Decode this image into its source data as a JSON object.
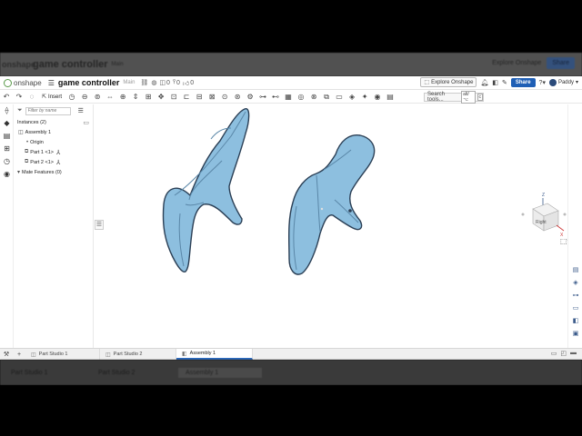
{
  "ghost": {
    "app": "onshape",
    "title": "game controller",
    "branch": "Main",
    "explore": "Explore Onshape",
    "share": "Share",
    "tabs": [
      "Part Studio 1",
      "Part Studio 2",
      "Assembly 1"
    ]
  },
  "header": {
    "app_name": "onshape",
    "doc_title": "game controller",
    "branch": "Main",
    "count_a": "0",
    "count_b": "0",
    "count_c": "0",
    "explore_label": "Explore Onshape",
    "share_label": "Share",
    "user_name": "Paddy"
  },
  "toolbar": {
    "insert_label": "Insert",
    "search_label": "Search tools...",
    "search_kbd": "alt/⌥",
    "search_kbd2": "c"
  },
  "panel": {
    "filter_placeholder": "Filter by name",
    "instances_label": "Instances (2)",
    "assembly_label": "Assembly 1",
    "origin_label": "Origin",
    "part1_label": "Part 1 <1>",
    "part2_label": "Part 2 <1>",
    "mate_features_label": "Mate Features (0)"
  },
  "viewcube": {
    "face_label": "Right",
    "z_label": "Z",
    "x_label": "X"
  },
  "tabs": [
    {
      "label": "Part Studio 1"
    },
    {
      "label": "Part Studio 2"
    },
    {
      "label": "Assembly 1"
    }
  ],
  "colors": {
    "part_fill": "#8dbfdf",
    "part_edge": "#2b3f55",
    "accent": "#1f5fb5"
  }
}
